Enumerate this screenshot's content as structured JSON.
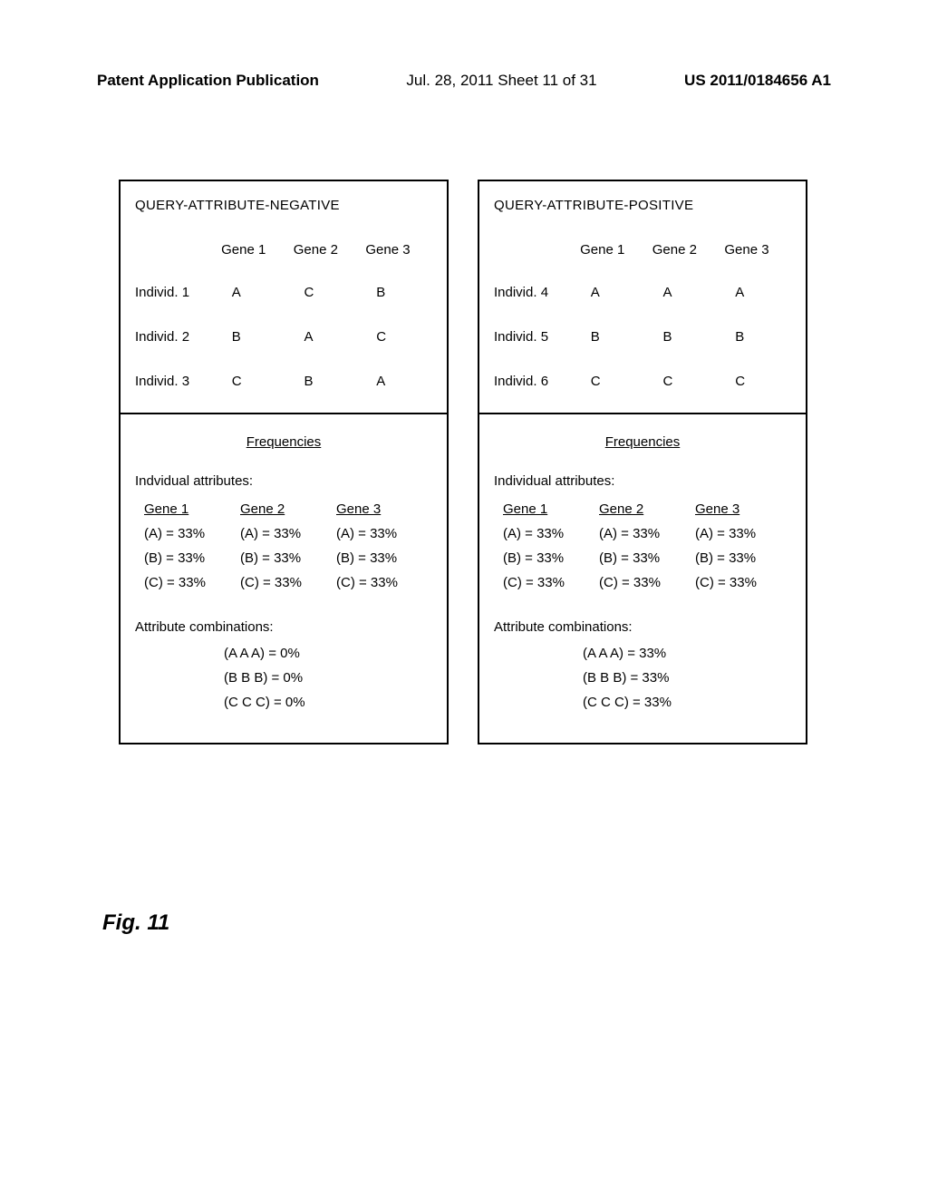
{
  "header": {
    "left": "Patent Application Publication",
    "center": "Jul. 28, 2011  Sheet 11 of 31",
    "right": "US 2011/0184656 A1"
  },
  "negative": {
    "title": "QUERY-ATTRIBUTE-NEGATIVE",
    "gene_headers": [
      "Gene 1",
      "Gene 2",
      "Gene 3"
    ],
    "rows": [
      {
        "label": "Individ. 1",
        "vals": [
          "A",
          "C",
          "B"
        ]
      },
      {
        "label": "Individ. 2",
        "vals": [
          "B",
          "A",
          "C"
        ]
      },
      {
        "label": "Individ. 3",
        "vals": [
          "C",
          "B",
          "A"
        ]
      }
    ],
    "freq_title": "Frequencies",
    "indiv_label": "Indvidual attributes:",
    "freq_headers": [
      "Gene 1",
      "Gene 2",
      "Gene 3"
    ],
    "freq_rows": [
      [
        "(A) = 33%",
        "(A) = 33%",
        "(A) = 33%"
      ],
      [
        "(B) = 33%",
        "(B) = 33%",
        "(B) = 33%"
      ],
      [
        "(C) = 33%",
        "(C) = 33%",
        "(C) = 33%"
      ]
    ],
    "comb_label": "Attribute combinations:",
    "combs": [
      "(A A A) = 0%",
      "(B B B) = 0%",
      "(C C C) = 0%"
    ]
  },
  "positive": {
    "title": "QUERY-ATTRIBUTE-POSITIVE",
    "gene_headers": [
      "Gene 1",
      "Gene 2",
      "Gene 3"
    ],
    "rows": [
      {
        "label": "Individ. 4",
        "vals": [
          "A",
          "A",
          "A"
        ]
      },
      {
        "label": "Individ. 5",
        "vals": [
          "B",
          "B",
          "B"
        ]
      },
      {
        "label": "Individ. 6",
        "vals": [
          "C",
          "C",
          "C"
        ]
      }
    ],
    "freq_title": "Frequencies",
    "indiv_label": "Individual attributes:",
    "freq_headers": [
      "Gene 1",
      "Gene 2",
      "Gene 3"
    ],
    "freq_rows": [
      [
        "(A) = 33%",
        "(A) = 33%",
        "(A) = 33%"
      ],
      [
        "(B) = 33%",
        "(B) = 33%",
        "(B) = 33%"
      ],
      [
        "(C) = 33%",
        "(C) = 33%",
        "(C) = 33%"
      ]
    ],
    "comb_label": "Attribute combinations:",
    "combs": [
      "(A A A) = 33%",
      "(B B B) = 33%",
      "(C C C) = 33%"
    ]
  },
  "figure_label": "Fig. 11"
}
